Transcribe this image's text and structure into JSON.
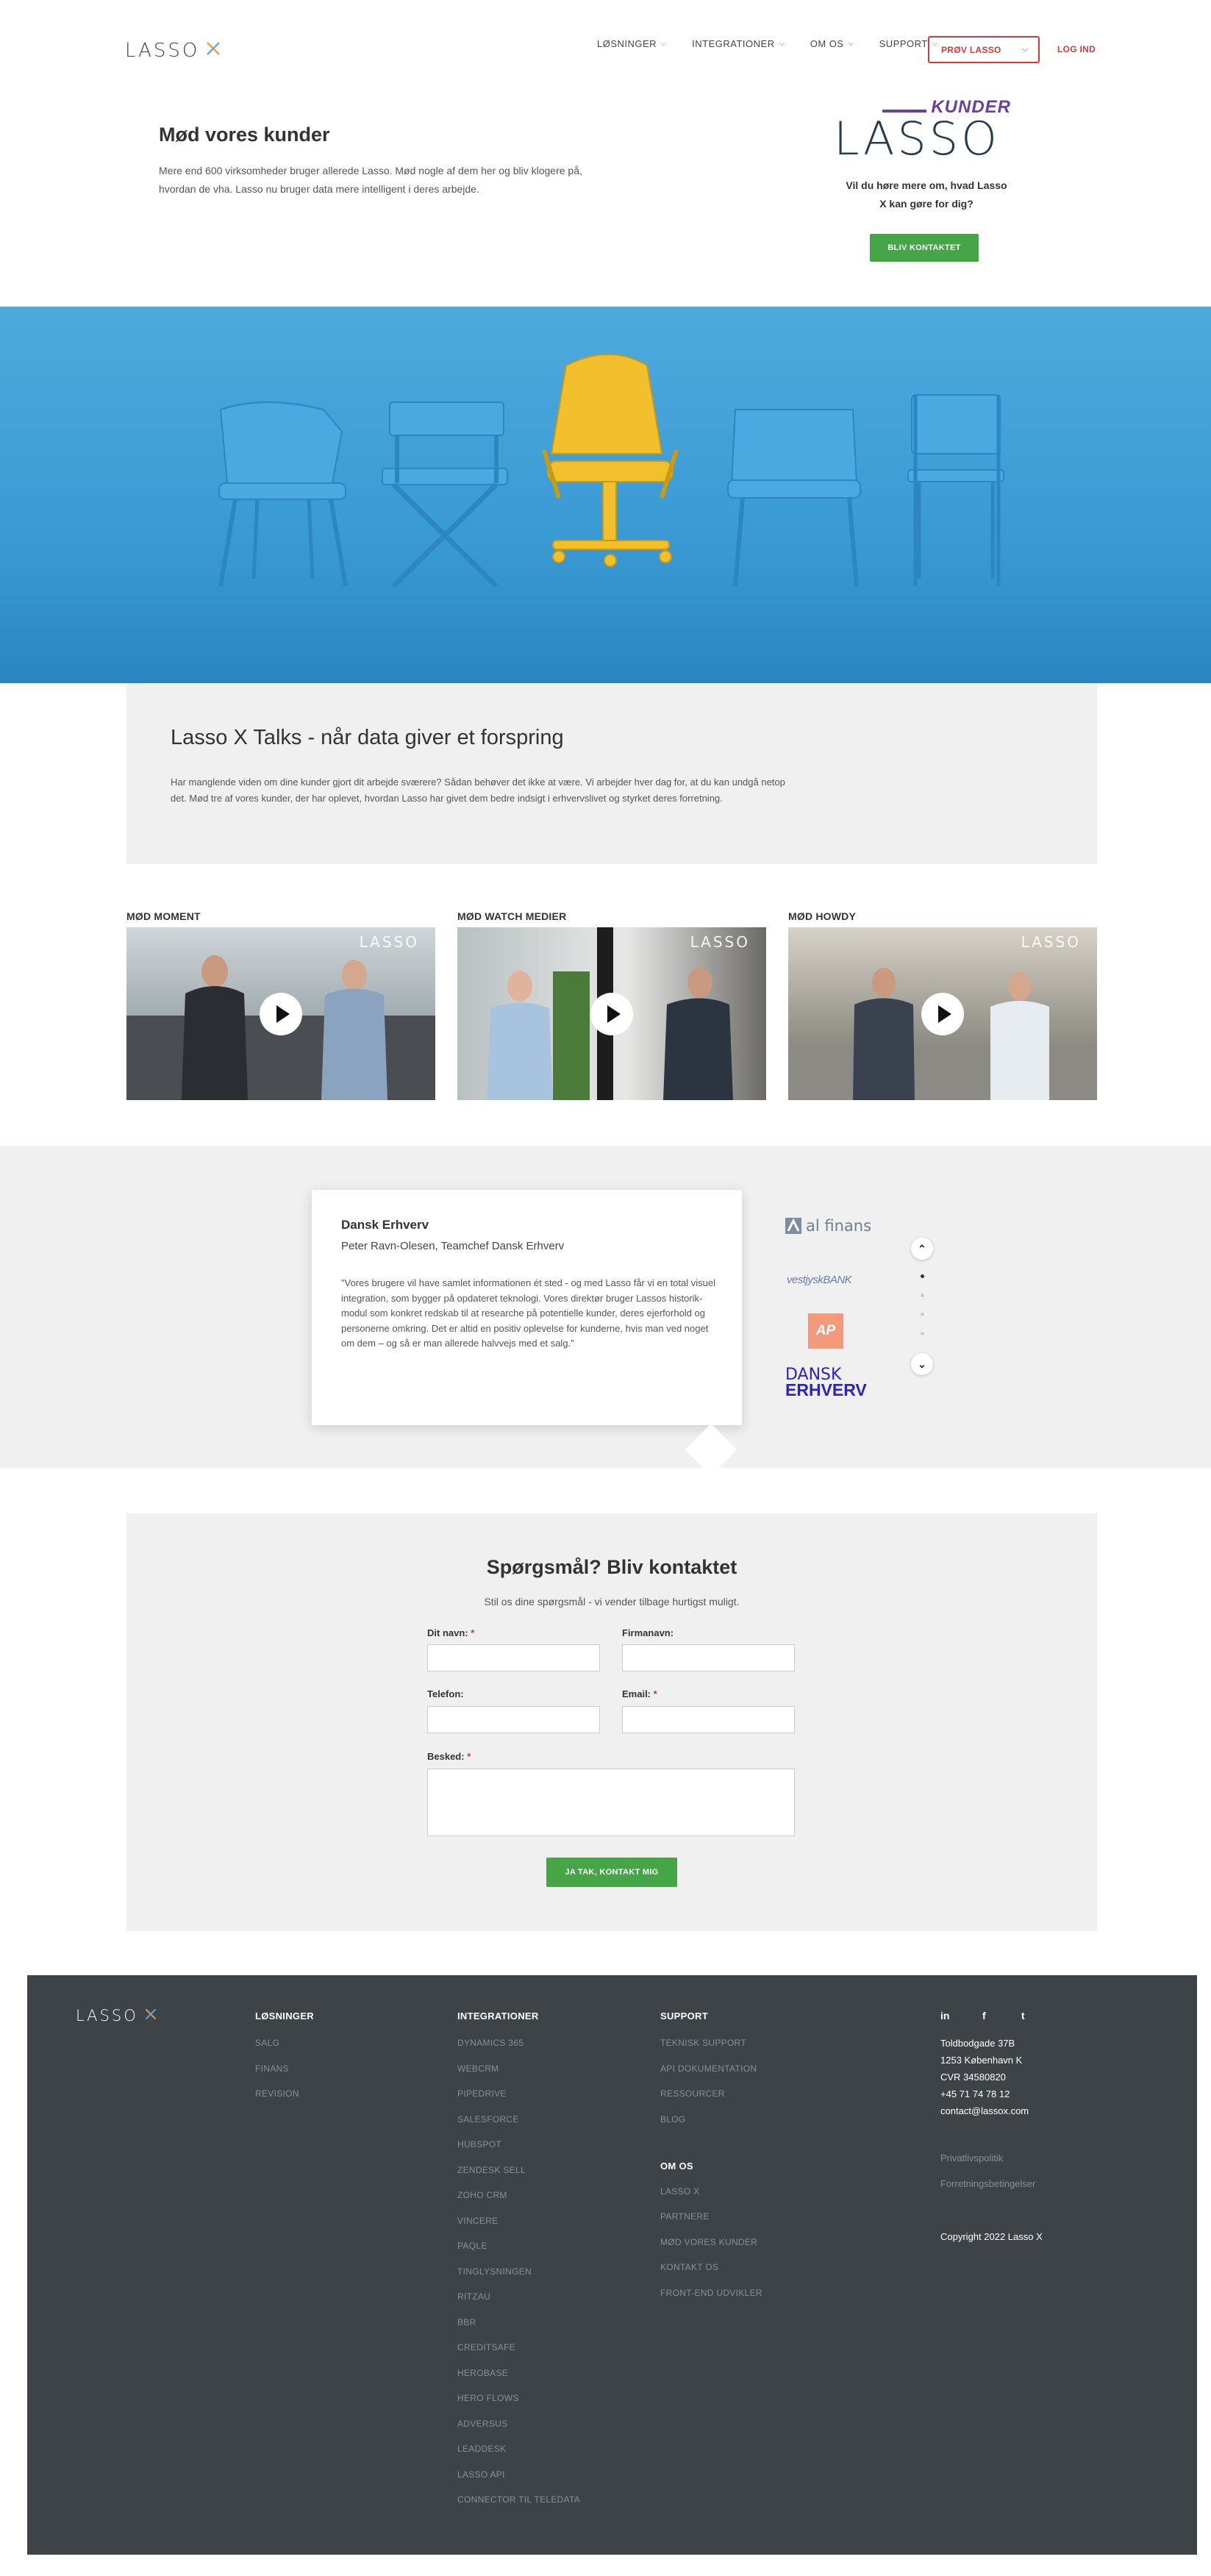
{
  "header": {
    "logo_text": "LASSO",
    "logo_mark": "X",
    "nav": [
      {
        "label": "LØSNINGER",
        "chev": "⌵"
      },
      {
        "label": "INTEGRATIONER",
        "chev": "⌵"
      },
      {
        "label": "OM OS",
        "chev": "⌵"
      },
      {
        "label": "SUPPORT",
        "chev": "⌵"
      }
    ],
    "try_label": "PRØV LASSO",
    "try_chev": "⌵",
    "login_label": "LOG IND"
  },
  "intro": {
    "title": "Mød vores kunder",
    "text": "Mere end 600 virksomheder bruger allerede Lasso. Mød nogle af dem her og bliv klogere på, hvordan de vha. Lasso nu bruger data mere intelligent i deres arbejde.",
    "badge_top": "KUNDER",
    "badge_main": "LASSO",
    "cta_question": "Vil du høre mere om, hvad Lasso X kan gøre for dig?",
    "cta_button": "BLIV KONTAKTET"
  },
  "talks": {
    "title": "Lasso X Talks - når data giver et forspring",
    "text": "Har manglende viden om dine kunder gjort dit arbejde sværere? Sådan behøver det ikke at være. Vi arbejder hver dag for, at du kan undgå netop det. Mød tre af vores kunder, der har oplevet, hvordan Lasso har givet dem bedre indsigt i erhvervslivet og styrket deres forretning."
  },
  "videos": [
    {
      "label": "MØD MOMENT",
      "watermark": "LASSO"
    },
    {
      "label": "MØD WATCH MEDIER",
      "watermark": "LASSO"
    },
    {
      "label": "MØD HOWDY",
      "watermark": "LASSO"
    }
  ],
  "testimonial": {
    "company": "Dansk Erhverv",
    "person": "Peter Ravn-Olesen, Teamchef Dansk Erhverv",
    "quote": "\"Vores brugere vil have samlet informationen ét sted - og med Lasso får vi en total visuel integration, som bygger på opdateret teknologi. Vores direktør bruger Lassos historik-modul som konkret redskab til at researche på potentielle kunder, deres ejerforhold og personerne omkring. Det er altid en positiv oplevelse for kunderne, hvis man ved noget om dem – og så er man allerede halvvejs med et salg.\"",
    "brands": [
      "al finans",
      "vestjyskBANK",
      "AP",
      "DANSK",
      "ERHVERV"
    ],
    "up_arrow": "⌃",
    "down_arrow": "⌄"
  },
  "contact": {
    "title": "Spørgsmål? Bliv kontaktet",
    "subtitle": "Stil os dine spørgsmål - vi vender tilbage hurtigst muligt.",
    "name_label": "Dit navn:",
    "company_label": "Firmanavn:",
    "phone_label": "Telefon:",
    "email_label": "Email:",
    "message_label": "Besked:",
    "required_mark": "*",
    "submit_label": "JA TAK, KONTAKT MIG"
  },
  "footer": {
    "logo_text": "LASSO",
    "logo_mark": "X",
    "solutions_title": "LØSNINGER",
    "solutions": [
      "SALG",
      "FINANS",
      "REVISION"
    ],
    "integrations_title": "INTEGRATIONER",
    "integrations": [
      "DYNAMICS 365",
      "WEBCRM",
      "PIPEDRIVE",
      "SALESFORCE",
      "HUBSPOT",
      "ZENDESK SELL",
      "ZOHO CRM",
      "VINCERE",
      "PAQLE",
      "TINGLYSNINGEN",
      "RITZAU",
      "BBR",
      "CREDITSAFE",
      "HEROBASE",
      "HERO FLOWS",
      "ADVERSUS",
      "LEADDESK",
      "LASSO API",
      "CONNECTOR TIL TELEDATA"
    ],
    "support_title": "SUPPORT",
    "support": [
      "TEKNISK SUPPORT",
      "API DOKUMENTATION",
      "RESSOURCER",
      "BLOG"
    ],
    "about_title": "OM OS",
    "about": [
      "LASSO X",
      "PARTNERE",
      "MØD VORES KUNDER",
      "KONTAKT OS",
      "FRONT-END UDVIKLER"
    ],
    "social": [
      "in",
      "f",
      "t"
    ],
    "address": [
      "Toldbodgade 37B",
      "1253 København K",
      "CVR 34580820",
      "+45 71 74 78 12",
      "contact@lassox.com"
    ],
    "privacy": "Privatlivspolitik",
    "terms": "Forretningsbetingelser",
    "copyright": "Copyright 2022 Lasso X"
  }
}
